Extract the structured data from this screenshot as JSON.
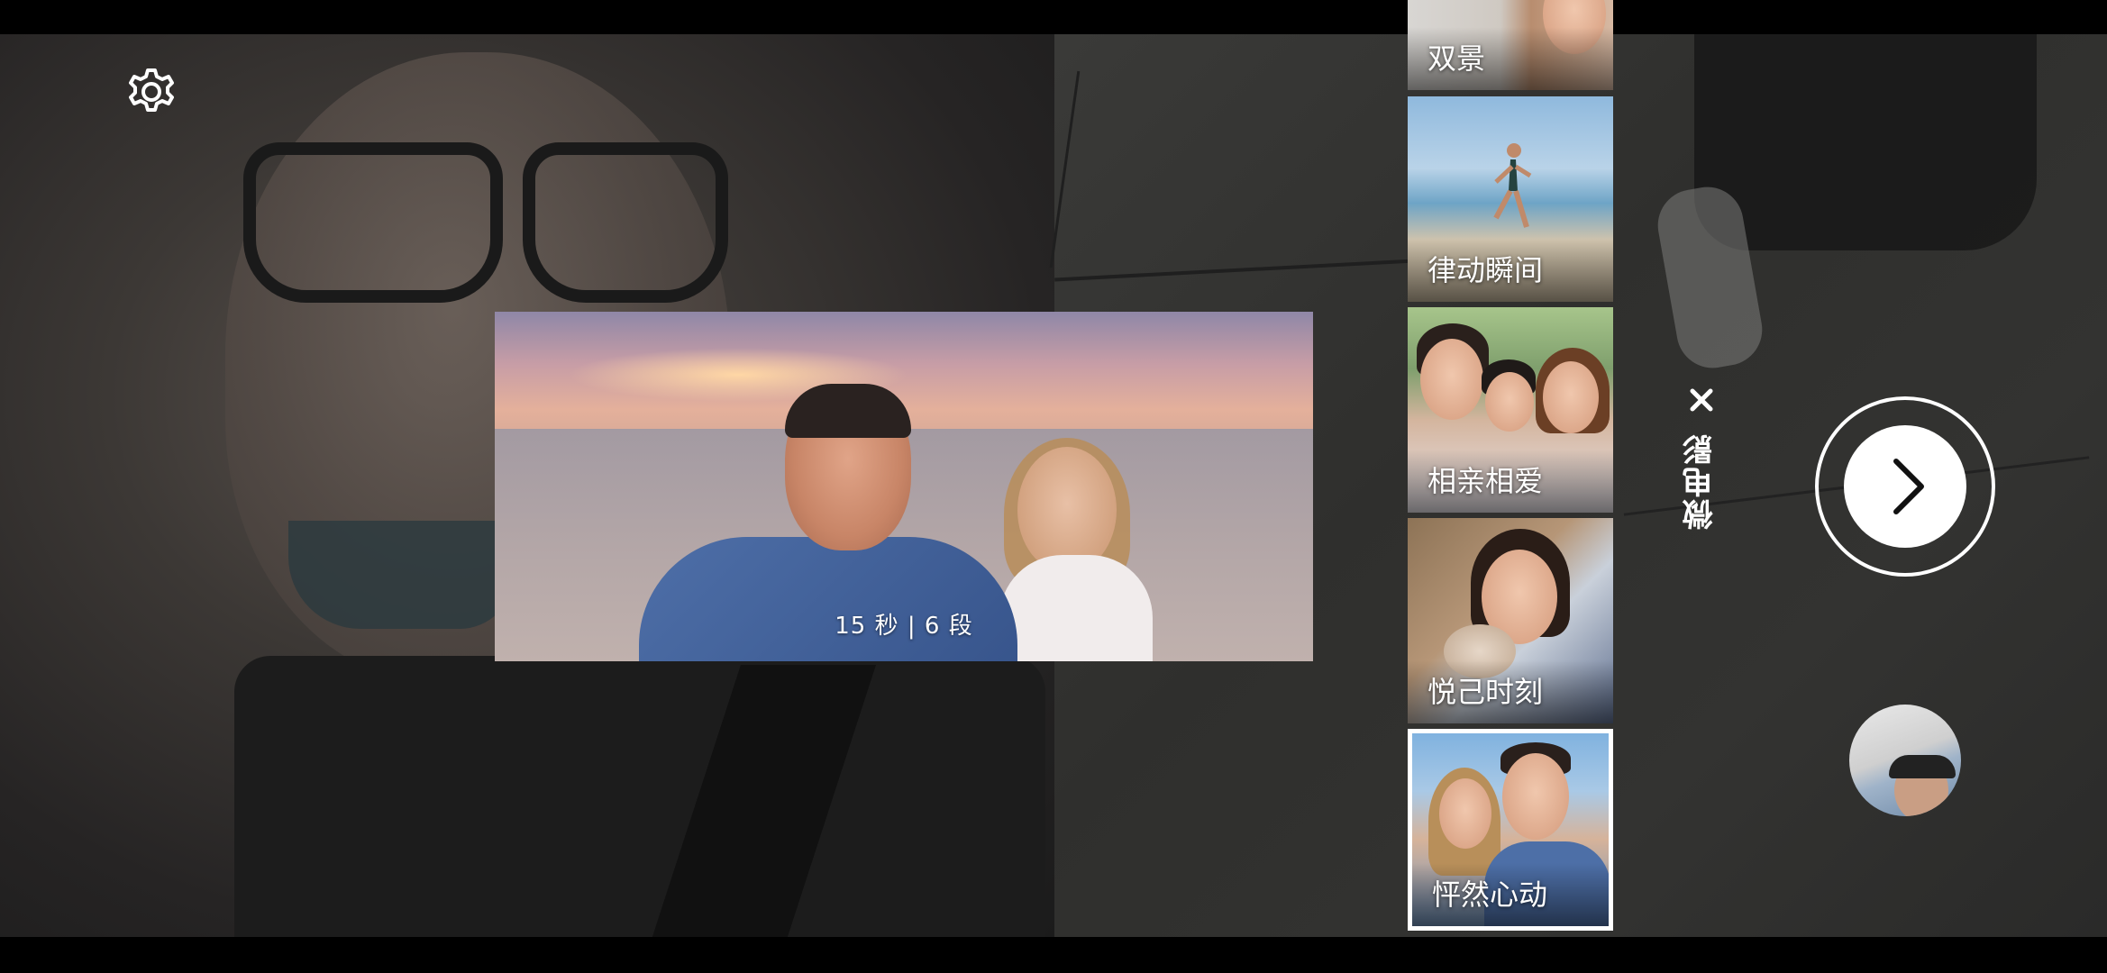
{
  "camera": {
    "mode_title": "微电影",
    "preview_caption": "15 秒 | 6 段"
  },
  "templates": [
    {
      "label": "双景",
      "selected": false
    },
    {
      "label": "律动瞬间",
      "selected": false
    },
    {
      "label": "相亲相爱",
      "selected": false
    },
    {
      "label": "悦己时刻",
      "selected": false
    },
    {
      "label": "怦然心动",
      "selected": true
    }
  ],
  "icons": {
    "settings": "gear-icon",
    "close": "close-icon",
    "next": "chevron-right-icon",
    "gallery": "gallery-thumbnail"
  },
  "colors": {
    "accent": "#ffffff",
    "background": "#000000"
  }
}
